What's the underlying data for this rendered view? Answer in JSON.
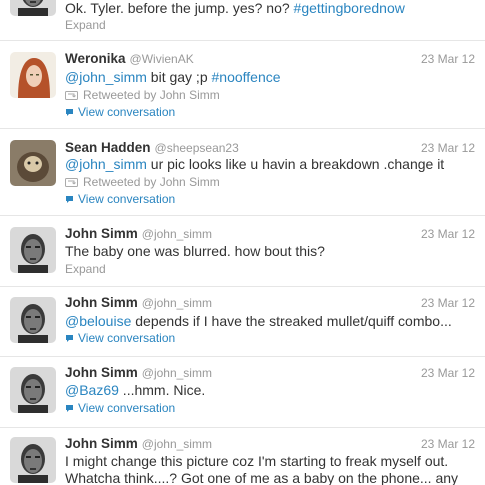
{
  "colors": {
    "link": "#2a85c0",
    "muted": "#999999",
    "text": "#333333",
    "divider": "#e6e6e6"
  },
  "tweets": [
    {
      "text_plain": "Ok. Tyler. before the jump. yes? no? ",
      "hashtag": "#gettingborednow",
      "expand": "Expand"
    },
    {
      "name": "Weronika",
      "handle": "@WivienAK",
      "date": "23 Mar 12",
      "mention": "@john_simm",
      "text_plain": " bit gay ;p ",
      "hashtag": "#nooffence",
      "retweeted_by": "Retweeted by John Simm",
      "view_conversation": "View conversation"
    },
    {
      "name": "Sean Hadden",
      "handle": "@sheepsean23",
      "date": "23 Mar 12",
      "mention": "@john_simm",
      "text_plain": " ur pic looks like u havin a breakdown .change it",
      "retweeted_by": "Retweeted by John Simm",
      "view_conversation": "View conversation"
    },
    {
      "name": "John Simm",
      "handle": "@john_simm",
      "date": "23 Mar 12",
      "text_plain": "The baby one was blurred. how bout this?",
      "expand": "Expand"
    },
    {
      "name": "John Simm",
      "handle": "@john_simm",
      "date": "23 Mar 12",
      "mention": "@belouise",
      "text_plain": " depends if I have the streaked mullet/quiff combo...",
      "view_conversation": "View conversation"
    },
    {
      "name": "John Simm",
      "handle": "@john_simm",
      "date": "23 Mar 12",
      "mention": "@Baz69",
      "text_plain": " ...hmm. Nice.",
      "view_conversation": "View conversation"
    },
    {
      "name": "John Simm",
      "handle": "@john_simm",
      "date": "23 Mar 12",
      "text_line1": "I might change this picture coz I'm starting to freak myself out.",
      "text_line2": "Whatcha think....? Got one of me as a baby on the phone... any"
    }
  ]
}
